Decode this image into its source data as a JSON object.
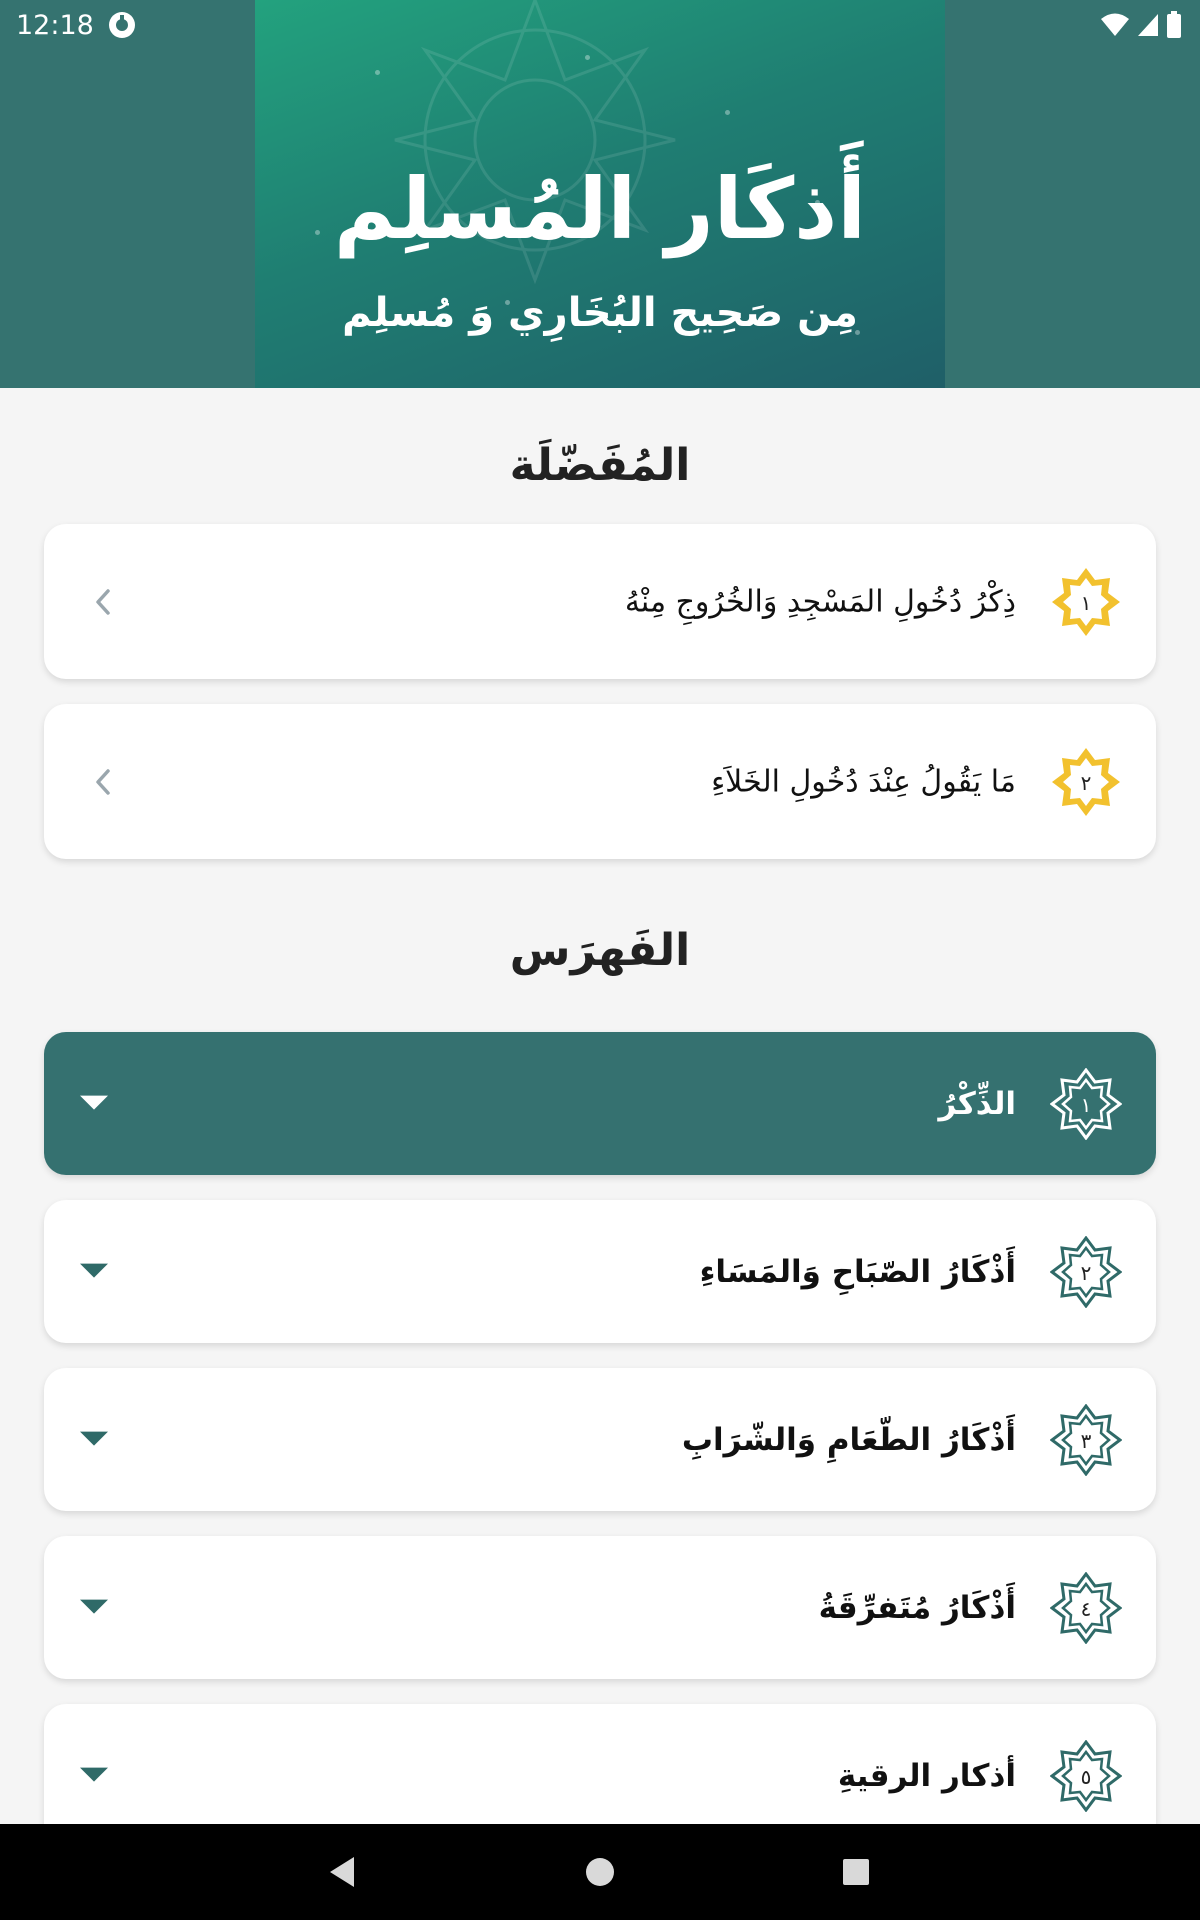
{
  "status_bar": {
    "time": "12:18"
  },
  "header": {
    "title": "أَذكَار المُسلِم",
    "subtitle": "مِن صَحِيح البُخَارِي وَ مُسلِم"
  },
  "favorites": {
    "title": "المُفَضّلَة",
    "items": [
      {
        "number": "١",
        "label": "ذِكْرُ دُخُولِ المَسْجِدِ وَالخُرُوجِ مِنْهُ"
      },
      {
        "number": "٢",
        "label": "مَا يَقُولُ عِنْدَ دُخُولِ الخَلاَءِ"
      }
    ]
  },
  "index": {
    "title": "الفَهرَس",
    "items": [
      {
        "number": "١",
        "label": "الذِّكْرُ",
        "expanded": true
      },
      {
        "number": "٢",
        "label": "أَذْكَارُ الصّبَاحِ وَالمَسَاءِ",
        "expanded": false
      },
      {
        "number": "٣",
        "label": "أَذْكَارُ الطّعَامِ وَالشّرَابِ",
        "expanded": false
      },
      {
        "number": "٤",
        "label": "أَذْكَارُ مُتَفرِّقَةُ",
        "expanded": false
      },
      {
        "number": "٥",
        "label": "أذكار الرقيةِ",
        "expanded": false
      }
    ]
  },
  "colors": {
    "header_bg": "#357370",
    "gold_badge": "#f2c12e",
    "teal_badge": "#2f6a68",
    "active_card": "#357170"
  }
}
